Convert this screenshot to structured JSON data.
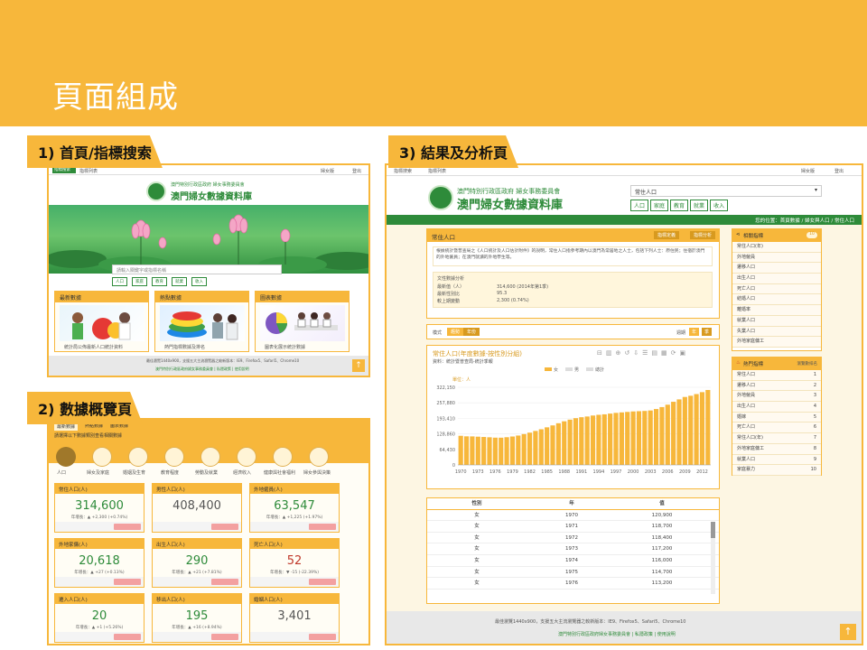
{
  "title": "頁面組成",
  "sections": {
    "s1": "1) 首頁/指標搜索",
    "s2": "2) 數據概覽頁",
    "s3": "3) 結果及分析頁"
  },
  "common": {
    "gov_line": "澳門特別行政區政府 婦女事務委員會",
    "db_title": "澳門婦女數據資料庫",
    "nav_search": "指標搜索",
    "nav_list": "指標列表",
    "mobile": "婦女版",
    "exit": "登出",
    "footer1": "最佳瀏覽1440x900，支援五大主流瀏覽器之較新版本：IE9、Firefox5、Safari5、Chrome10",
    "footer2": "澳門特別行政區政府婦女事務委員會 | 私隱政策 | 使用說明"
  },
  "home": {
    "search_placeholder": "請輸入關鍵字或指標名稱",
    "tags": [
      "人口",
      "家庭",
      "教育",
      "就業",
      "收入"
    ],
    "cards": [
      {
        "title": "最新數據",
        "caption": "統計局公佈最新人口統計資料"
      },
      {
        "title": "熱點數據",
        "caption": "熱門指標數據及排名"
      },
      {
        "title": "圖表數據",
        "caption": "圖表化展示統計數據"
      }
    ]
  },
  "overview": {
    "tabs": [
      "最新數據",
      "熱點數據",
      "圖表數據"
    ],
    "sub": "請選擇以下數據類別查看相關數據",
    "icons": [
      "人口",
      "婦女及家庭",
      "婚姻及生育",
      "教育程度",
      "勞動及就業",
      "經濟收入",
      "健康與社會福利",
      "婦女參與決策"
    ],
    "kpis": [
      {
        "title": "常住人口",
        "unit": "(人)",
        "value": "314,600",
        "color": "#2e8b3a",
        "note": "年增長：▲ +2,300 (+0.74%)"
      },
      {
        "title": "男性人口",
        "unit": "(人)",
        "value": "408,400",
        "color": "#555",
        "note": ""
      },
      {
        "title": "外地僱員",
        "unit": "(人)",
        "value": "63,547",
        "color": "#2e8b3a",
        "note": "年增長：▲ +1,225 (+1.97%)"
      },
      {
        "title": "外地家傭",
        "unit": "(人)",
        "value": "20,618",
        "color": "#2e8b3a",
        "note": "年增長：▲ +27 (+0.13%)"
      },
      {
        "title": "出生人口",
        "unit": "(人)",
        "value": "290",
        "color": "#2e8b3a",
        "note": "年增長：▲ +21 (+7.81%)"
      },
      {
        "title": "死亡人口",
        "unit": "(人)",
        "value": "52",
        "color": "#c0392b",
        "note": "年增長：▼ -15 (-22.39%)"
      },
      {
        "title": "遷入人口",
        "unit": "(人)",
        "value": "20",
        "color": "#2e8b3a",
        "note": "年增長：▲ +1 (+5.26%)"
      },
      {
        "title": "移出人口",
        "unit": "(人)",
        "value": "195",
        "color": "#2e8b3a",
        "note": "年增長：▲ +16 (+8.94%)"
      },
      {
        "title": "婚姻人口",
        "unit": "(人)",
        "value": "3,401",
        "color": "#555",
        "note": ""
      }
    ]
  },
  "result": {
    "breadcrumb": "您的位置：首頁數據 / 婦女與人口 / 常住人口",
    "search_value": "常住人口",
    "tags": [
      "人口",
      "家庭",
      "教育",
      "就業",
      "收入"
    ],
    "panel_title": "常住人口",
    "btn_def": "指標定義",
    "btn_analysis": "指標分析",
    "definition": "根據統計暨普查局之《人口統計及人口估計附件》的說明，常住人口指參考期內以澳門為常居地之人士，包括下列人士：原住民；住宿於澳門的外地僱員；在澳門就讀的外地學生等。",
    "stats_title": "文性數據分析",
    "stats": [
      [
        "最新值（人）",
        "314,600 (2014年第1季)"
      ],
      [
        "最新性別比",
        "95.3"
      ],
      [
        "較上期變動",
        "2,300 (0.74%)"
      ]
    ],
    "mode_label": "模式",
    "mode_opts": [
      "趨勢",
      "年份"
    ],
    "period_label": "週期",
    "period_opts": [
      "年",
      "季"
    ],
    "chart_title": "常住人口(年度數據-按性別分組)",
    "chart_src": "資料：統計暨普查局-統計季報",
    "legend": [
      "女",
      "男",
      "總計"
    ],
    "unit": "單位：人",
    "side1_title": "相關指標",
    "side1": [
      "常住人口(年)",
      "外地僱員",
      "遷移人口",
      "出生人口",
      "死亡人口",
      "結婚人口",
      "離婚率",
      "就業人口",
      "失業人口",
      "外地家庭傭工"
    ],
    "side2_title": "熱門指標",
    "side2_sub": "瀏覽數排名",
    "side2": [
      [
        "常住人口",
        "1"
      ],
      [
        "遷移人口",
        "2"
      ],
      [
        "外地僱員",
        "3"
      ],
      [
        "出生人口",
        "4"
      ],
      [
        "婚嫁",
        "5"
      ],
      [
        "死亡人口",
        "6"
      ],
      [
        "常住人口(年)",
        "7"
      ],
      [
        "外地家庭傭工",
        "8"
      ],
      [
        "就業人口",
        "9"
      ],
      [
        "家庭暴力",
        "10"
      ]
    ],
    "table_head": [
      "性別",
      "年",
      "值"
    ],
    "table": [
      [
        "女",
        "1970",
        "120,900"
      ],
      [
        "女",
        "1971",
        "118,700"
      ],
      [
        "女",
        "1972",
        "118,400"
      ],
      [
        "女",
        "1973",
        "117,200"
      ],
      [
        "女",
        "1974",
        "116,000"
      ],
      [
        "女",
        "1975",
        "114,700"
      ],
      [
        "女",
        "1976",
        "113,200"
      ]
    ]
  },
  "chart_data": {
    "type": "bar",
    "title": "常住人口(年度數據-按性別分組)",
    "ylabel": "單位：人",
    "ylim": [
      0,
      322150
    ],
    "yticks": [
      0,
      64430,
      128860,
      193410,
      257880,
      322150
    ],
    "xticks": [
      "1970",
      "1973",
      "1976",
      "1979",
      "1982",
      "1985",
      "1988",
      "1991",
      "1994",
      "1997",
      "2000",
      "2003",
      "2006",
      "2009",
      "2012"
    ],
    "categories": [
      "1970",
      "1971",
      "1972",
      "1973",
      "1974",
      "1975",
      "1976",
      "1977",
      "1978",
      "1979",
      "1980",
      "1981",
      "1982",
      "1983",
      "1984",
      "1985",
      "1986",
      "1987",
      "1988",
      "1989",
      "1990",
      "1991",
      "1992",
      "1993",
      "1994",
      "1995",
      "1996",
      "1997",
      "1998",
      "1999",
      "2000",
      "2001",
      "2002",
      "2003",
      "2004",
      "2005",
      "2006",
      "2007",
      "2008",
      "2009",
      "2010",
      "2011",
      "2012",
      "2013"
    ],
    "series": [
      {
        "name": "女",
        "values": [
          120900,
          118700,
          118400,
          117200,
          116000,
          114700,
          113200,
          113000,
          115000,
          118000,
          122000,
          128000,
          134000,
          141000,
          148000,
          156000,
          164000,
          173000,
          181000,
          188000,
          194000,
          198000,
          201000,
          205000,
          208000,
          210000,
          213000,
          216000,
          218000,
          220000,
          222000,
          223000,
          224000,
          226000,
          232000,
          240000,
          250000,
          262000,
          272000,
          282000,
          287000,
          294000,
          302000,
          311000
        ]
      }
    ]
  }
}
